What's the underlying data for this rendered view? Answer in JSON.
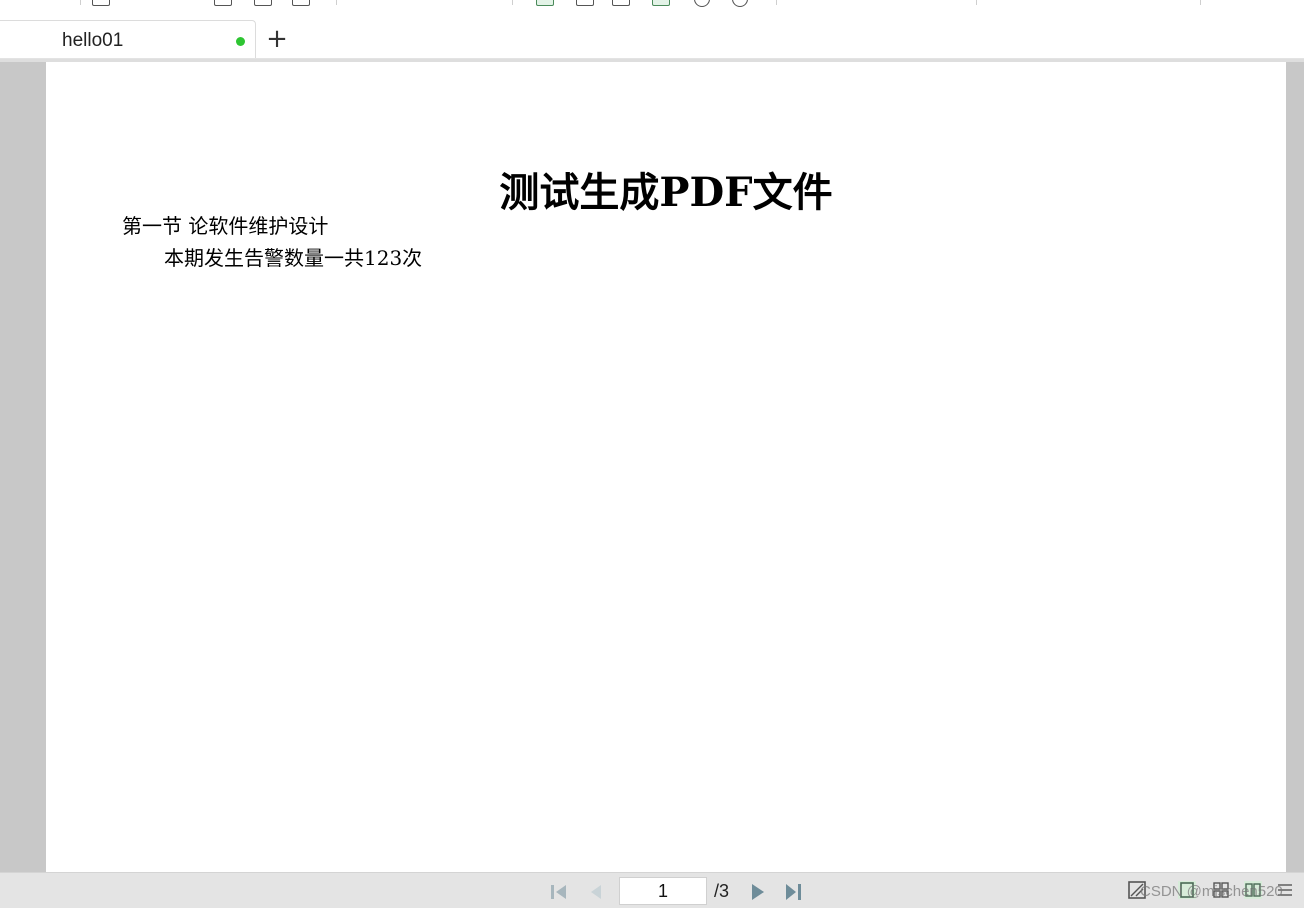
{
  "tabs": [
    {
      "label": "hello01",
      "modified": true
    }
  ],
  "new_tab_label": "+",
  "document": {
    "title": "测试生成PDF文件",
    "section_heading": "第一节 论软件维护设计",
    "paragraph": "本期发生告警数量一共123次"
  },
  "pagination": {
    "current_page": "1",
    "total_label": "/3"
  },
  "watermark": "CSDN @mischen520",
  "colors": {
    "modified_dot": "#2ec532",
    "viewer_background": "#c8c8c8",
    "status_bar": "#e4e4e4",
    "active_view_button": "#d7ecd9"
  },
  "icons": {
    "first_page": "first-page-icon",
    "previous_page": "previous-page-icon",
    "next_page": "next-page-icon",
    "last_page": "last-page-icon"
  }
}
